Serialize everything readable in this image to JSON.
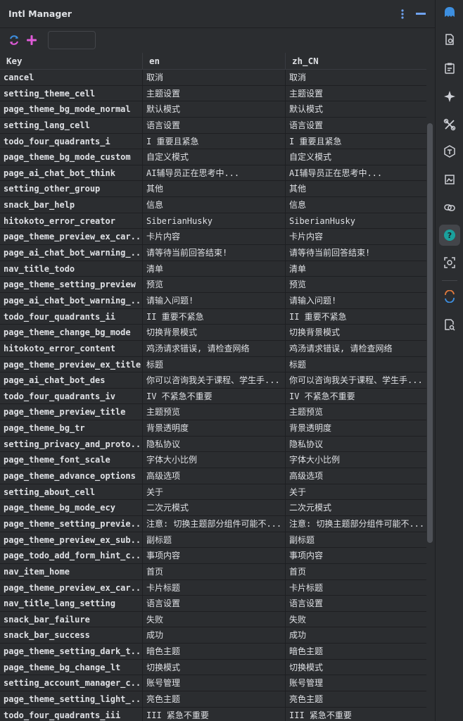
{
  "window": {
    "title": "Intl Manager"
  },
  "colors": {
    "panel_bg": "#2b2d30",
    "editor_bg": "#1e1f22",
    "text": "#dfe1e5",
    "accent_blue": "#3d8fe0",
    "accent_magenta": "#e05bd9",
    "accent_teal": "#1aa09c"
  },
  "toolbar": {
    "refresh_icon": "refresh-icon",
    "add_icon": "plus-icon",
    "search_value": ""
  },
  "title_actions": {
    "more_icon": "kebab-icon",
    "minimize_icon": "minimize-icon"
  },
  "table": {
    "columns": [
      "Key",
      "en",
      "zh_CN"
    ],
    "rows": [
      [
        "cancel",
        "取消",
        "取消"
      ],
      [
        "setting_theme_cell",
        "主题设置",
        "主题设置"
      ],
      [
        "page_theme_bg_mode_normal",
        "默认模式",
        "默认模式"
      ],
      [
        "setting_lang_cell",
        "语言设置",
        "语言设置"
      ],
      [
        "todo_four_quadrants_i",
        "I 重要且紧急",
        "I 重要且紧急"
      ],
      [
        "page_theme_bg_mode_custom",
        "自定义模式",
        "自定义模式"
      ],
      [
        "page_ai_chat_bot_think",
        "AI辅导员正在思考中...",
        "AI辅导员正在思考中..."
      ],
      [
        "setting_other_group",
        "其他",
        "其他"
      ],
      [
        "snack_bar_help",
        "信息",
        "信息"
      ],
      [
        "hitokoto_error_creator",
        "SiberianHusky",
        "SiberianHusky"
      ],
      [
        "page_theme_preview_ex_car...",
        "卡片内容",
        "卡片内容"
      ],
      [
        "page_ai_chat_bot_warning_...",
        "请等待当前回答结束!",
        "请等待当前回答结束!"
      ],
      [
        "nav_title_todo",
        "清单",
        "清单"
      ],
      [
        "page_theme_setting_preview",
        "预览",
        "预览"
      ],
      [
        "page_ai_chat_bot_warning_...",
        "请输入问题!",
        "请输入问题!"
      ],
      [
        "todo_four_quadrants_ii",
        "II 重要不紧急",
        "II 重要不紧急"
      ],
      [
        "page_theme_change_bg_mode",
        "切换背景模式",
        "切换背景模式"
      ],
      [
        "hitokoto_error_content",
        "鸡汤请求错误, 请检查网络",
        "鸡汤请求错误, 请检查网络"
      ],
      [
        "page_theme_preview_ex_title",
        "标题",
        "标题"
      ],
      [
        "page_ai_chat_bot_des",
        "你可以咨询我关于课程、学生手...",
        "你可以咨询我关于课程、学生手..."
      ],
      [
        "todo_four_quadrants_iv",
        "IV 不紧急不重要",
        "IV 不紧急不重要"
      ],
      [
        "page_theme_preview_title",
        "主题预览",
        "主题预览"
      ],
      [
        "page_theme_bg_tr",
        "背景透明度",
        "背景透明度"
      ],
      [
        "setting_privacy_and_proto...",
        "隐私协议",
        "隐私协议"
      ],
      [
        "page_theme_font_scale",
        "字体大小比例",
        "字体大小比例"
      ],
      [
        "page_theme_advance_options",
        "高级选项",
        "高级选项"
      ],
      [
        "setting_about_cell",
        "关于",
        "关于"
      ],
      [
        "page_theme_bg_mode_ecy",
        "二次元模式",
        "二次元模式"
      ],
      [
        "page_theme_setting_previe...",
        "注意: 切换主题部分组件可能不...",
        "注意: 切换主题部分组件可能不..."
      ],
      [
        "page_theme_preview_ex_sub...",
        "副标题",
        "副标题"
      ],
      [
        "page_todo_add_form_hint_c...",
        "事项内容",
        "事项内容"
      ],
      [
        "nav_item_home",
        "首页",
        "首页"
      ],
      [
        "page_theme_preview_ex_car...",
        "卡片标题",
        "卡片标题"
      ],
      [
        "nav_title_lang_setting",
        "语言设置",
        "语言设置"
      ],
      [
        "snack_bar_failure",
        "失败",
        "失败"
      ],
      [
        "snack_bar_success",
        "成功",
        "成功"
      ],
      [
        "page_theme_setting_dark_t...",
        "暗色主题",
        "暗色主题"
      ],
      [
        "page_theme_bg_change_lt",
        "切换模式",
        "切换模式"
      ],
      [
        "setting_account_manager_c...",
        "账号管理",
        "账号管理"
      ],
      [
        "page_theme_setting_light_...",
        "亮色主题",
        "亮色主题"
      ],
      [
        "todo_four_quadrants_iii",
        "III 紧急不重要",
        "III 紧急不重要"
      ]
    ]
  },
  "right_strip": {
    "icons": [
      "assistant-icon",
      "file-search-icon",
      "clipboard-icon",
      "sparkle-icon",
      "tools-icon",
      "translate-icon",
      "image-check-icon",
      "link-icon",
      "help-icon",
      "screenshot-search-icon",
      "sync-icon",
      "document-search-icon"
    ]
  }
}
